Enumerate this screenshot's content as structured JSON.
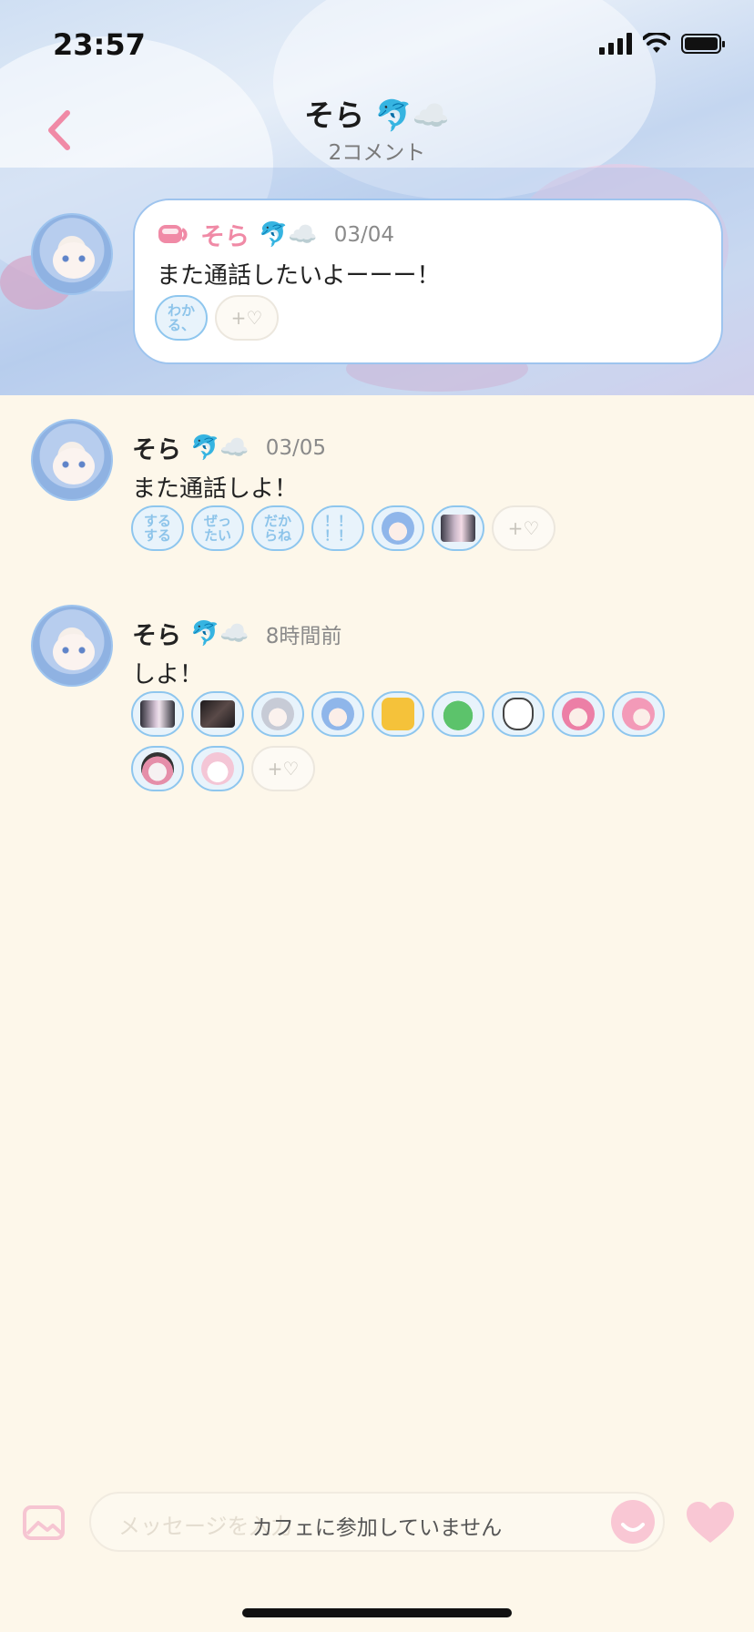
{
  "status_bar": {
    "time": "23:57"
  },
  "header": {
    "title": "そら 🐬☁️",
    "subtitle": "2コメント"
  },
  "comments": [
    {
      "name": "そら",
      "emoji": "🐬☁️",
      "date": "03/04",
      "text": "また通話したいよーーー！",
      "reactions": [
        {
          "type": "text",
          "label": "わか\nる、"
        }
      ]
    },
    {
      "name": "そら",
      "emoji": "🐬☁️",
      "date": "03/05",
      "text": "また通話しよ！",
      "reactions": [
        {
          "type": "text",
          "label": "する\nする"
        },
        {
          "type": "text",
          "label": "ぜっ\nたい"
        },
        {
          "type": "text",
          "label": "だか\nらね"
        },
        {
          "type": "text",
          "label": "！！\n！！"
        },
        {
          "type": "image",
          "icon": "blue-hair-character-sticker"
        },
        {
          "type": "image",
          "icon": "photo-sticker"
        }
      ]
    },
    {
      "name": "そら",
      "emoji": "🐬☁️",
      "date": "8時間前",
      "text": "しよ！",
      "reactions": [
        {
          "type": "image",
          "icon": "photo-sticker"
        },
        {
          "type": "image",
          "icon": "dark-photo-sticker"
        },
        {
          "type": "image",
          "icon": "silver-hair-character-sticker"
        },
        {
          "type": "image",
          "icon": "blue-hair-character-sticker"
        },
        {
          "type": "image",
          "icon": "yellow-cat-sticker"
        },
        {
          "type": "image",
          "icon": "green-frog-sticker"
        },
        {
          "type": "image",
          "icon": "white-cat-sticker"
        },
        {
          "type": "image",
          "icon": "pink-hair-character-sticker"
        },
        {
          "type": "image",
          "icon": "pink-heart-character-sticker"
        },
        {
          "type": "image",
          "icon": "pink-bear-character-sticker"
        },
        {
          "type": "image",
          "icon": "white-hair-heart-sticker"
        }
      ]
    }
  ],
  "add_reaction_label": "+♡",
  "composer": {
    "placeholder": "メッセージを入力",
    "notice": "カフェに参加していません"
  },
  "colors": {
    "accent_pink": "#f5a3ba",
    "reaction_border": "#8ec6ee",
    "background": "#fdf7ea"
  }
}
